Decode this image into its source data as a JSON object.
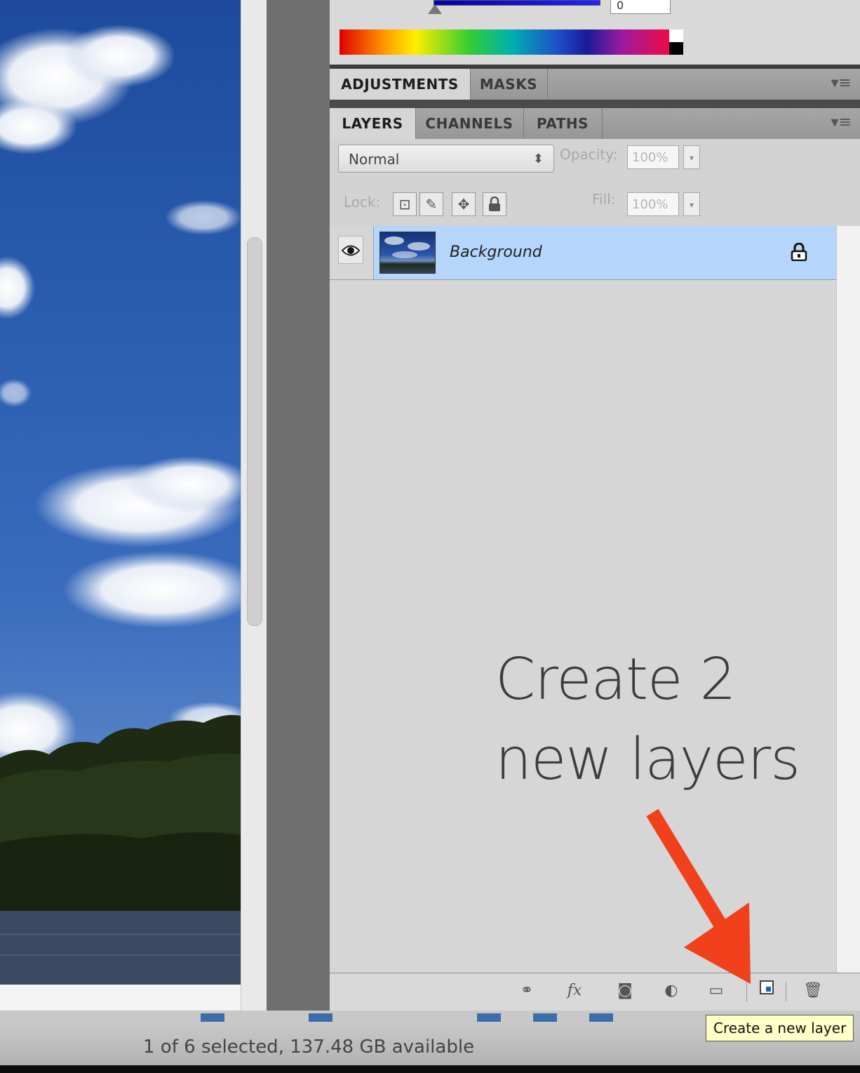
{
  "color_panel": {
    "value": "0"
  },
  "adjustments_tabs": [
    "ADJUSTMENTS",
    "MASKS"
  ],
  "layers_tabs": [
    "LAYERS",
    "CHANNELS",
    "PATHS"
  ],
  "layers_panel": {
    "blend_mode": "Normal",
    "opacity_label": "Opacity:",
    "opacity_value": "100%",
    "lock_label": "Lock:",
    "fill_label": "Fill:",
    "fill_value": "100%",
    "layers": [
      {
        "name": "Background",
        "visible": true,
        "locked": true
      }
    ],
    "selection_color": "#b5d5fb"
  },
  "annotation": {
    "line1": "Create 2",
    "line2": "new layers",
    "arrow_color": "#f0401c"
  },
  "bottom_toolbar": {
    "icons": [
      "link-icon",
      "fx-icon",
      "mask-icon",
      "adjustment-icon",
      "folder-icon",
      "new-layer-icon",
      "trash-icon"
    ],
    "fx_label": "fx"
  },
  "tooltip": "Create a new layer",
  "status": "1 of 6 selected, 137.48 GB available"
}
